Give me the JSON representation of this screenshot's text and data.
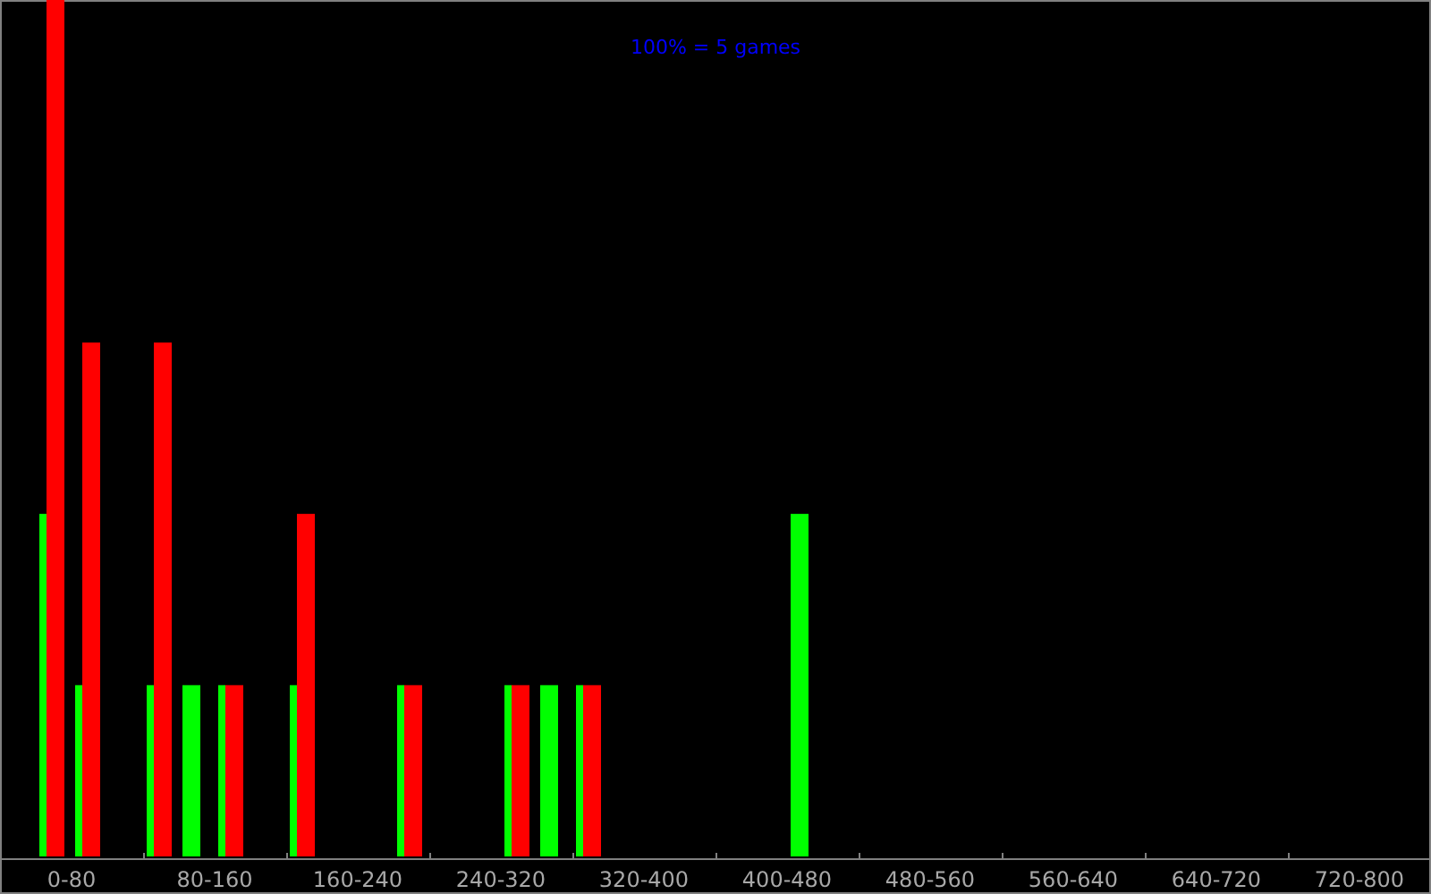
{
  "chart": {
    "title": "100% = 5 games",
    "axis_labels": [
      "0-80",
      "80-160",
      "160-240",
      "240-320",
      "320-400",
      "400-480",
      "480-560",
      "560-640",
      "640-720",
      "720-800"
    ]
  }
}
